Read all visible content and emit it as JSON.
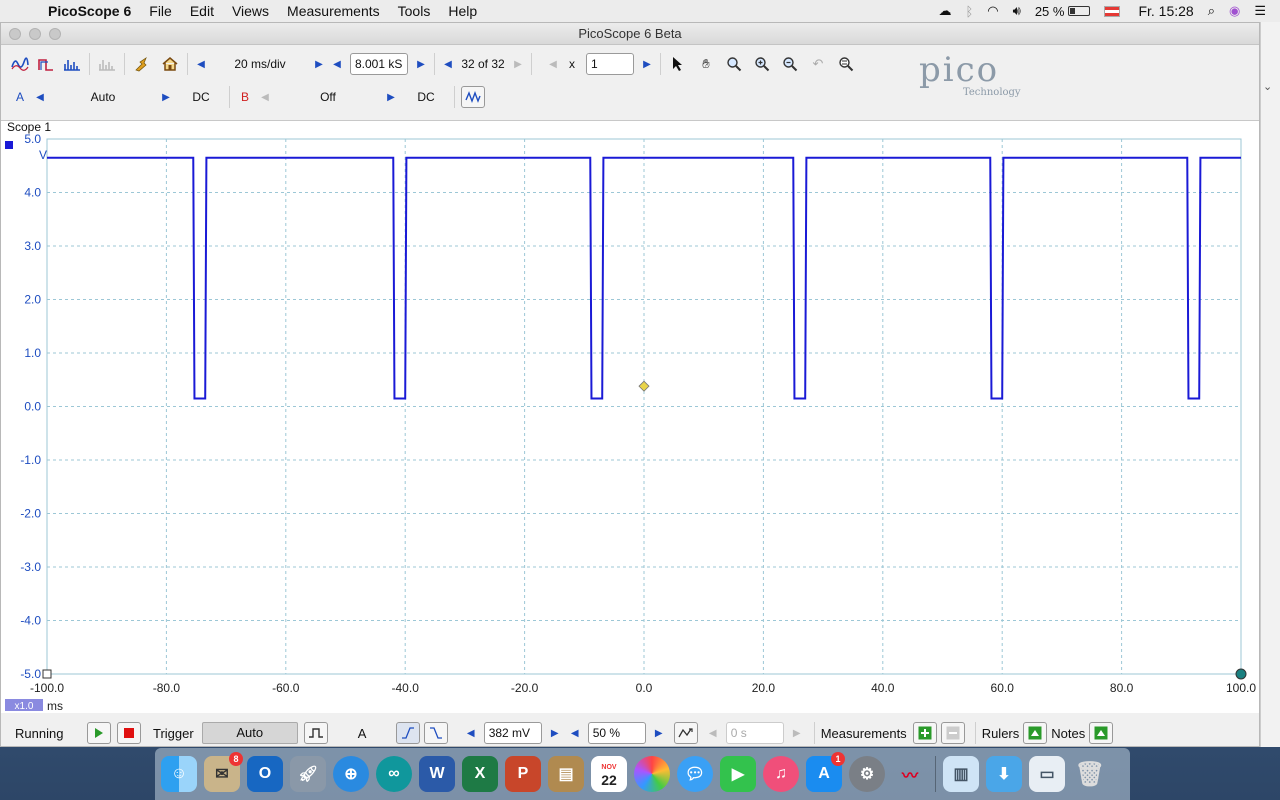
{
  "menubar": {
    "app_name": "PicoScope 6",
    "items": [
      "File",
      "Edit",
      "Views",
      "Measurements",
      "Tools",
      "Help"
    ],
    "battery": "25 %",
    "clock": "Fr. 15:28"
  },
  "window": {
    "title": "PicoScope 6 Beta"
  },
  "toolbar": {
    "timebase": "20 ms/div",
    "samples": "8.001 kS",
    "buffer": "32 of 32",
    "zoom_prefix": "x",
    "zoom_value": "1",
    "channel_a_label": "A",
    "channel_a_range": "Auto",
    "channel_a_coupling": "DC",
    "channel_b_label": "B",
    "channel_b_range": "Off",
    "channel_b_coupling": "DC"
  },
  "logo": {
    "word": "pico",
    "sub": "Technology"
  },
  "scope": {
    "tab_label": "Scope 1",
    "y_unit": "V",
    "x_unit": "ms",
    "zoom_badge": "x1.0",
    "y_ticks": [
      "5.0",
      "4.0",
      "3.0",
      "2.0",
      "1.0",
      "0.0",
      "-1.0",
      "-2.0",
      "-3.0",
      "-4.0",
      "-5.0"
    ],
    "x_ticks": [
      "-100.0",
      "-80.0",
      "-60.0",
      "-40.0",
      "-20.0",
      "0.0",
      "20.0",
      "40.0",
      "60.0",
      "80.0",
      "100.0"
    ],
    "trace_color": "#1a1ad6",
    "trigger_marker_color": "#e8d44a"
  },
  "chart_data": {
    "type": "line",
    "xlabel": "ms",
    "ylabel": "V",
    "xlim": [
      -100,
      100
    ],
    "ylim": [
      -5,
      5
    ],
    "grid": true,
    "series": [
      {
        "x": [
          -100,
          -75.5,
          -75.3,
          -73.5,
          -73.3,
          -42,
          -41.8,
          -40,
          -39.8,
          -9,
          -8.8,
          -7,
          -6.8,
          25,
          25.2,
          27,
          27.2,
          58,
          58.2,
          60,
          60.2,
          91,
          91.2,
          93,
          93.2,
          100
        ],
        "y": [
          4.65,
          4.65,
          0.15,
          0.15,
          4.65,
          4.65,
          0.15,
          0.15,
          4.65,
          4.65,
          0.15,
          0.15,
          4.65,
          4.65,
          0.15,
          0.15,
          4.65,
          4.65,
          0.15,
          0.15,
          4.65,
          4.65,
          0.15,
          0.15,
          4.65,
          4.65
        ]
      }
    ],
    "trigger_point": {
      "x": 0,
      "y": 0.38
    }
  },
  "status": {
    "state": "Running",
    "trigger_label": "Trigger",
    "trigger_mode": "Auto",
    "trigger_channel": "A",
    "threshold": "382 mV",
    "pre_trigger": "50 %",
    "delay": "0 s",
    "measurements_label": "Measurements",
    "rulers_label": "Rulers",
    "notes_label": "Notes"
  },
  "dock": {
    "calendar_month": "NOV",
    "calendar_day": "22",
    "mail_badge": "8",
    "appstore_badge": "1"
  }
}
